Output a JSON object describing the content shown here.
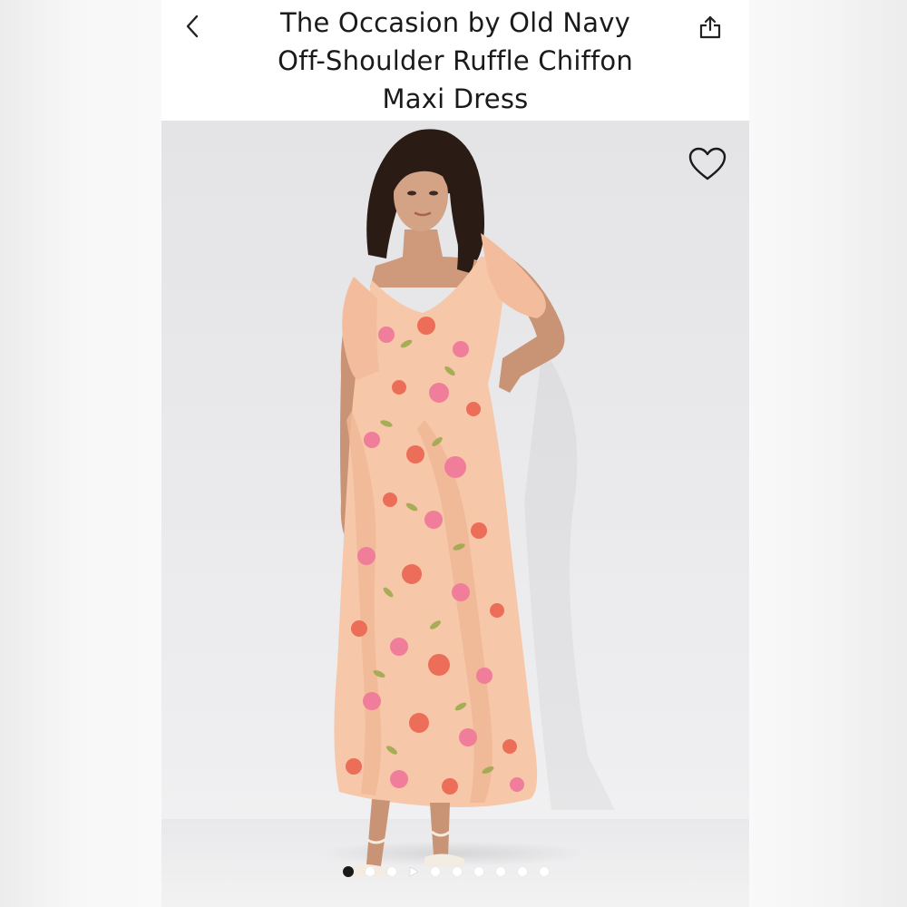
{
  "header": {
    "title_lines": [
      "The Occasion by Old Navy",
      "Off-Shoulder Ruffle Chiffon",
      "Maxi Dress"
    ],
    "back_icon": "chevron-left-icon",
    "share_icon": "share-icon"
  },
  "gallery": {
    "favorite_icon": "heart-outline-icon",
    "total_items": 10,
    "active_index": 0,
    "video_index": 3,
    "dress_colors": {
      "base": "#f6c7a8",
      "flower_pink": "#f07a9a",
      "flower_coral": "#ec6a55",
      "leaf": "#9aa84a"
    },
    "background_color": "#e9e9eb"
  }
}
